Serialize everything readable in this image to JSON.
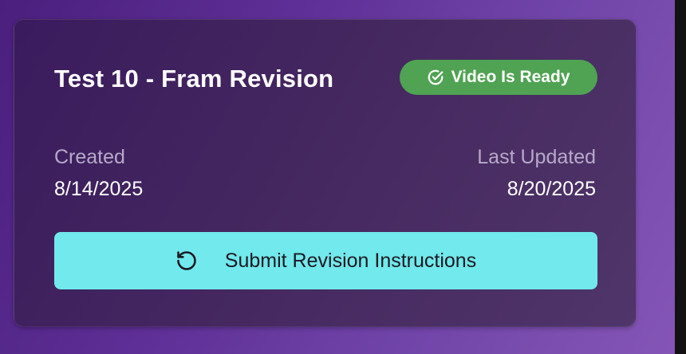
{
  "card": {
    "title": "Test 10 - Fram Revision",
    "status_badge": {
      "label": "Video Is Ready",
      "icon": "check-circle-icon",
      "color": "#4fa352"
    },
    "created": {
      "label": "Created",
      "value": "8/14/2025"
    },
    "last_updated": {
      "label": "Last Updated",
      "value": "8/20/2025"
    },
    "submit_button": {
      "label": "Submit Revision Instructions",
      "icon": "rotate-ccw-icon",
      "color": "#72e9ec"
    }
  }
}
